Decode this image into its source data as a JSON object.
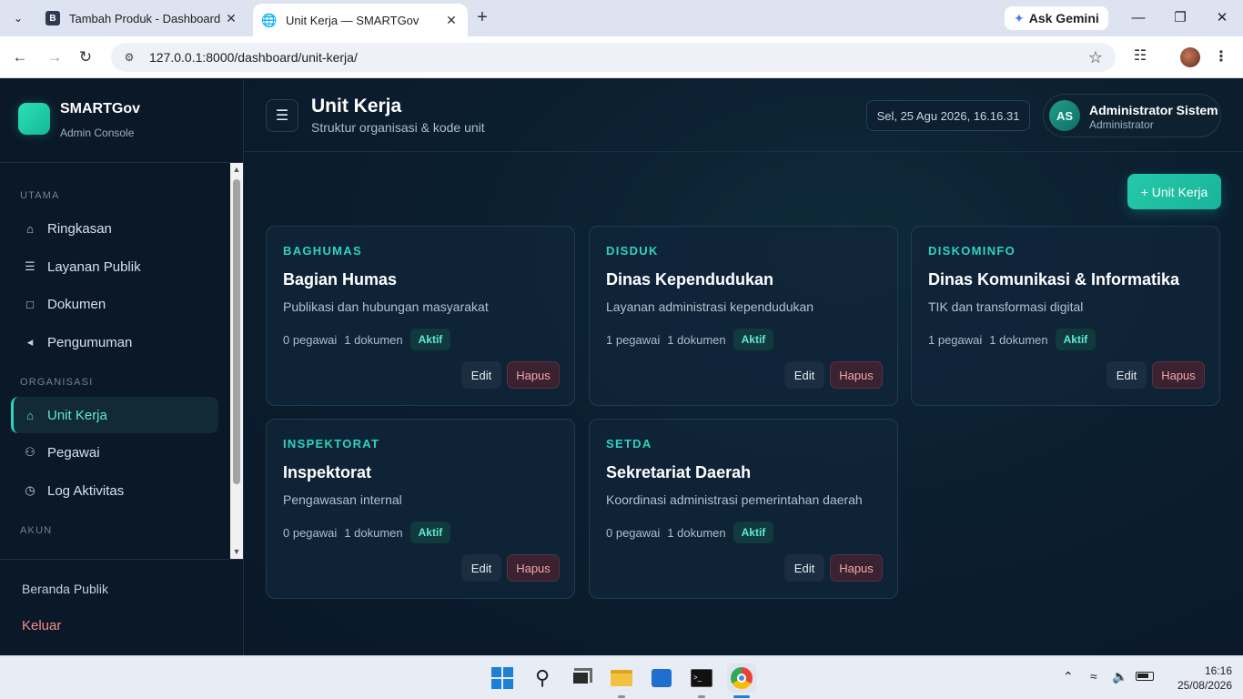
{
  "browser": {
    "tabs": [
      {
        "title": "Tambah Produk - Dashboard",
        "favicon": "B",
        "active": false
      },
      {
        "title": "Unit Kerja — SMARTGov",
        "favicon": "globe-icon",
        "active": true
      }
    ],
    "url": "127.0.0.1:8000/dashboard/unit-kerja/",
    "gemini_label": "Ask Gemini"
  },
  "sidebar": {
    "brand_name": "SMARTGov",
    "brand_sub": "Admin Console",
    "sections": {
      "utama": "UTAMA",
      "organisasi": "ORGANISASI",
      "akun": "AKUN"
    },
    "items": [
      {
        "label": "Ringkasan",
        "icon": "home-icon"
      },
      {
        "label": "Layanan Publik",
        "icon": "list-icon"
      },
      {
        "label": "Dokumen",
        "icon": "document-icon"
      },
      {
        "label": "Pengumuman",
        "icon": "megaphone-icon"
      },
      {
        "label": "Unit Kerja",
        "icon": "building-icon",
        "active": true
      },
      {
        "label": "Pegawai",
        "icon": "users-icon"
      },
      {
        "label": "Log Aktivitas",
        "icon": "clock-icon"
      }
    ],
    "footer": {
      "public_home": "Beranda Publik",
      "logout": "Keluar"
    }
  },
  "header": {
    "title": "Unit Kerja",
    "subtitle": "Struktur organisasi & kode unit",
    "datetime": "Sel, 25 Agu 2026, 16.16.31",
    "user": {
      "initials": "AS",
      "name": "Administrator Sistem",
      "role": "Administrator"
    }
  },
  "actions": {
    "add_label": "+ Unit Kerja"
  },
  "labels": {
    "edit": "Edit",
    "delete": "Hapus"
  },
  "units": [
    {
      "code": "BAGHUMAS",
      "name": "Bagian Humas",
      "description": "Publikasi dan hubungan masyarakat",
      "employees": "0 pegawai",
      "documents": "1 dokumen",
      "status": "Aktif"
    },
    {
      "code": "DISDUK",
      "name": "Dinas Kependudukan",
      "description": "Layanan administrasi kependudukan",
      "employees": "1 pegawai",
      "documents": "1 dokumen",
      "status": "Aktif"
    },
    {
      "code": "DISKOMINFO",
      "name": "Dinas Komunikasi & Informatika",
      "description": "TIK dan transformasi digital",
      "employees": "1 pegawai",
      "documents": "1 dokumen",
      "status": "Aktif"
    },
    {
      "code": "INSPEKTORAT",
      "name": "Inspektorat",
      "description": "Pengawasan internal",
      "employees": "0 pegawai",
      "documents": "1 dokumen",
      "status": "Aktif"
    },
    {
      "code": "SETDA",
      "name": "Sekretariat Daerah",
      "description": "Koordinasi administrasi pemerintahan daerah",
      "employees": "0 pegawai",
      "documents": "1 dokumen",
      "status": "Aktif"
    }
  ],
  "taskbar": {
    "time": "16:16",
    "date": "25/08/2026"
  },
  "colors": {
    "accent": "#2dd4bf",
    "danger": "#f6a4a4",
    "background": "#0b1a2b"
  }
}
